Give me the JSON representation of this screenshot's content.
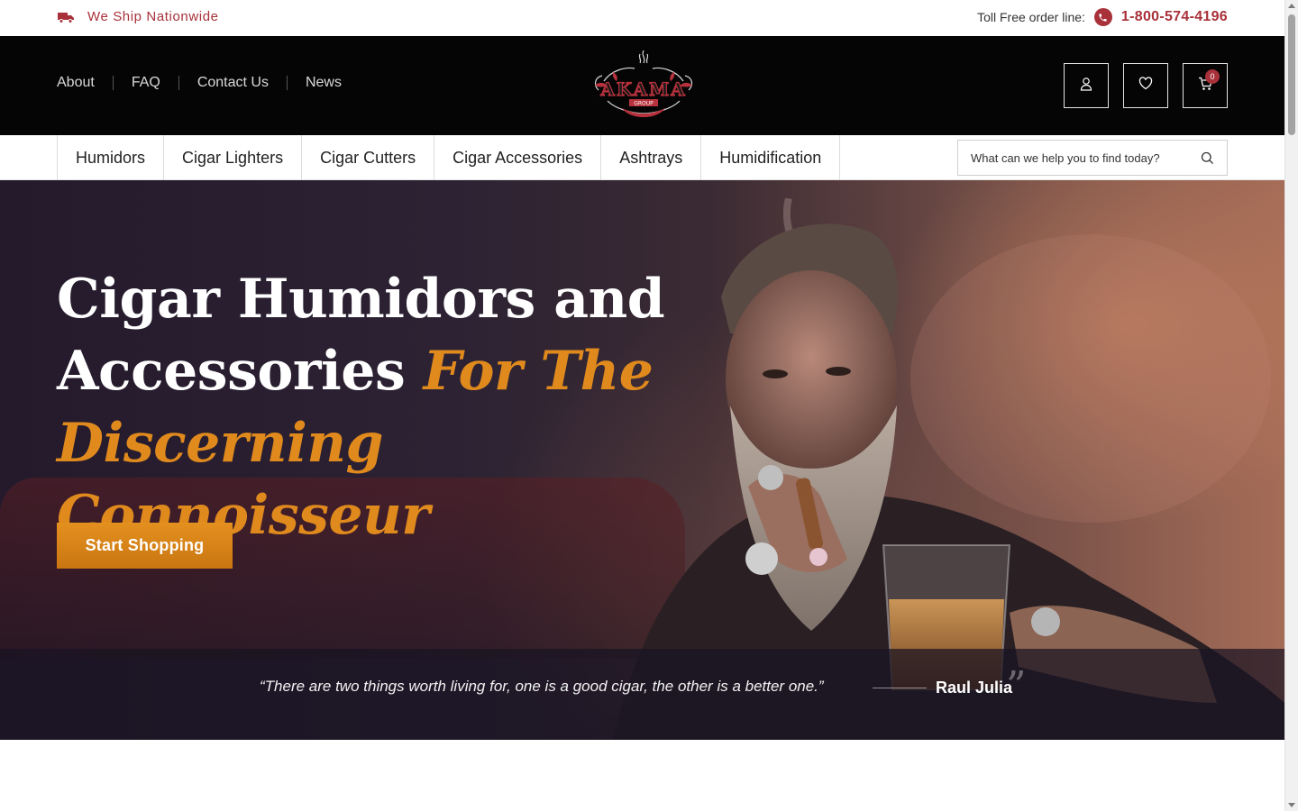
{
  "topbar": {
    "shipping_text": "We Ship Nationwide",
    "toll_free_label": "Toll Free order line:",
    "phone_number": "1-800-574-4196"
  },
  "header": {
    "nav": [
      "About",
      "FAQ",
      "Contact Us",
      "News"
    ],
    "logo_name": "AKAMA",
    "logo_sub": "GROUP",
    "cart_count": "0"
  },
  "categories": [
    "Humidors",
    "Cigar Lighters",
    "Cigar Cutters",
    "Cigar Accessories",
    "Ashtrays",
    "Humidification"
  ],
  "search": {
    "placeholder": "What can we help you to find today?"
  },
  "hero": {
    "title_line1": "Cigar Humidors and",
    "title_line2_plain": "Accessories ",
    "title_line2_accent": "For The",
    "title_line3_accent": "Discerning Connoisseur",
    "cta_label": "Start Shopping"
  },
  "quote": {
    "text": "“There are two things worth living for, one is a good cigar, the other is a better one.”",
    "author": "Raul Julia"
  },
  "colors": {
    "brand_red": "#a8313a",
    "accent_orange": "#e08a1e",
    "header_black": "#050505"
  },
  "icons": [
    "truck-icon",
    "phone-icon",
    "user-icon",
    "heart-icon",
    "cart-icon",
    "search-icon",
    "quote-icon"
  ]
}
